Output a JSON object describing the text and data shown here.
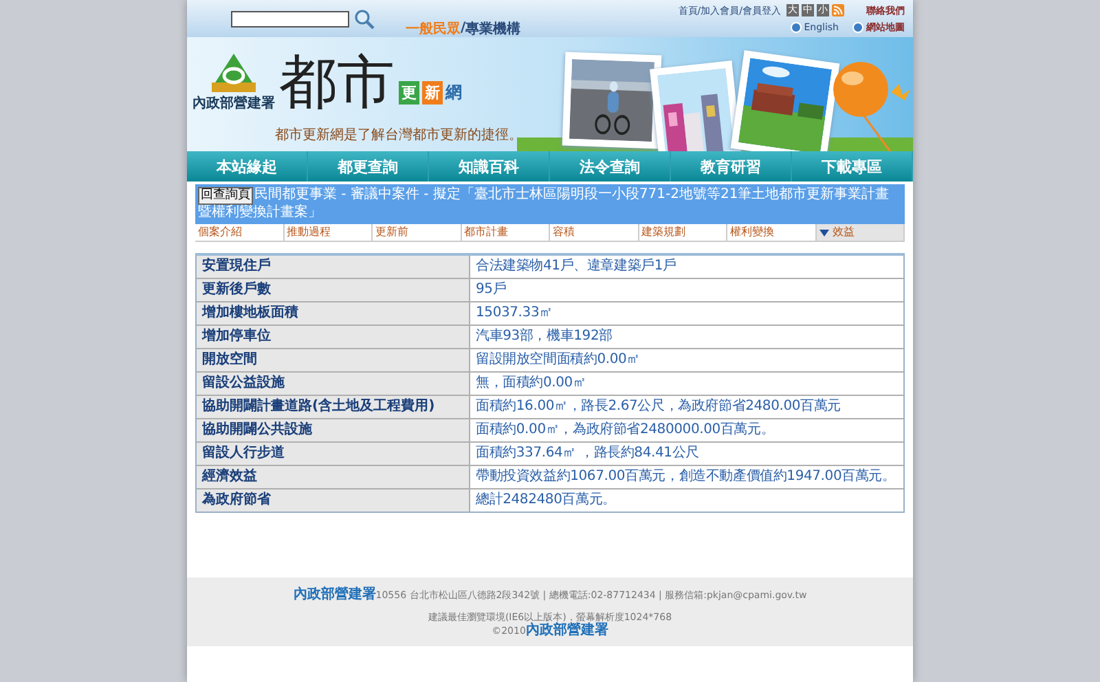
{
  "header": {
    "audience": [
      {
        "label": "一般民眾",
        "selected": true
      },
      {
        "label": "專業機構",
        "selected": false
      }
    ],
    "audience_separator": "/",
    "member_links": "首頁/加入會員/會員登入",
    "font_sizes": [
      {
        "label": "大",
        "selected": false
      },
      {
        "label": "中",
        "selected": false
      },
      {
        "label": "小",
        "selected": false
      }
    ],
    "contact": "聯絡我們",
    "english": "English",
    "sitemap": "網站地圖",
    "agency": "內政部營建署",
    "logo_title": "都市",
    "logo_boxes": [
      "更",
      "新"
    ],
    "logo_suffix": "網",
    "slogan": "都市更新網是了解台灣都市更新的捷徑。"
  },
  "main_nav": [
    "本站緣起",
    "都更查詢",
    "知識百科",
    "法令查詢",
    "教育研習",
    "下載專區"
  ],
  "case": {
    "back_button": "回查詢頁",
    "title": "民間都更事業 - 審議中案件 - 擬定「臺北市士林區陽明段一小段771-2地號等21筆土地都市更新事業計畫暨權利變換計畫案」"
  },
  "tabs": [
    {
      "label": "個案介紹",
      "selected": false
    },
    {
      "label": "推動過程",
      "selected": false
    },
    {
      "label": "更新前",
      "selected": false
    },
    {
      "label": "都市計畫",
      "selected": false
    },
    {
      "label": "容積",
      "selected": false
    },
    {
      "label": "建築規劃",
      "selected": false
    },
    {
      "label": "權利變換",
      "selected": false
    },
    {
      "label": "效益",
      "selected": true
    }
  ],
  "table": {
    "rows": [
      {
        "label": "安置現住戶",
        "value": "合法建築物41戶、違章建築戶1戶"
      },
      {
        "label": "更新後戶數",
        "value": "95戶"
      },
      {
        "label": "增加樓地板面積",
        "value": "15037.33㎡"
      },
      {
        "label": "增加停車位",
        "value": "汽車93部，機車192部"
      },
      {
        "label": "開放空間",
        "value": "留設開放空間面積約0.00㎡"
      },
      {
        "label": "留設公益設施",
        "value": "無，面積約0.00㎡"
      },
      {
        "label": "協助開闢計畫道路(含土地及工程費用)",
        "value": "面積約16.00㎡，路長2.67公尺，為政府節省2480.00百萬元"
      },
      {
        "label": "協助開闢公共設施",
        "value": "面積約0.00㎡，為政府節省2480000.00百萬元。"
      },
      {
        "label": "留設人行步道",
        "value": "面積約337.64㎡ ，路長約84.41公尺"
      },
      {
        "label": "經濟效益",
        "value": "帶動投資效益約1067.00百萬元，創造不動產價值約1947.00百萬元。"
      },
      {
        "label": "為政府節省",
        "value": "總計2482480百萬元。"
      }
    ]
  },
  "footer": {
    "org_link": "內政部營建署",
    "address": "10556 台北市松山區八德路2段342號 | 總機電話:02-87712434 | 服務信箱:pkjan@cpami.gov.tw",
    "browser_note": "建議最佳瀏覽環境(IE6以上版本)，螢幕解析度1024*768",
    "copyright": "©2010",
    "copyright_link": "內政部營建署"
  }
}
